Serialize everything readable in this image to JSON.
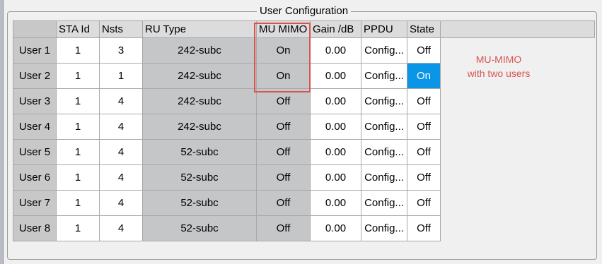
{
  "group": {
    "title": "User Configuration"
  },
  "columns": [
    "STA Id",
    "Nsts",
    "RU Type",
    "MU MIMO",
    "Gain /dB",
    "PPDU",
    "State"
  ],
  "rows": [
    {
      "user": "User 1",
      "sta_id": "1",
      "nsts": "3",
      "ru_type": "242-subc",
      "mu_mimo": "On",
      "gain": "0.00",
      "ppdu": "Config...",
      "state": "Off"
    },
    {
      "user": "User 2",
      "sta_id": "1",
      "nsts": "1",
      "ru_type": "242-subc",
      "mu_mimo": "On",
      "gain": "0.00",
      "ppdu": "Config...",
      "state": "On"
    },
    {
      "user": "User 3",
      "sta_id": "1",
      "nsts": "4",
      "ru_type": "242-subc",
      "mu_mimo": "Off",
      "gain": "0.00",
      "ppdu": "Config...",
      "state": "Off"
    },
    {
      "user": "User 4",
      "sta_id": "1",
      "nsts": "4",
      "ru_type": "242-subc",
      "mu_mimo": "Off",
      "gain": "0.00",
      "ppdu": "Config...",
      "state": "Off"
    },
    {
      "user": "User 5",
      "sta_id": "1",
      "nsts": "4",
      "ru_type": "52-subc",
      "mu_mimo": "Off",
      "gain": "0.00",
      "ppdu": "Config...",
      "state": "Off"
    },
    {
      "user": "User 6",
      "sta_id": "1",
      "nsts": "4",
      "ru_type": "52-subc",
      "mu_mimo": "Off",
      "gain": "0.00",
      "ppdu": "Config...",
      "state": "Off"
    },
    {
      "user": "User 7",
      "sta_id": "1",
      "nsts": "4",
      "ru_type": "52-subc",
      "mu_mimo": "Off",
      "gain": "0.00",
      "ppdu": "Config...",
      "state": "Off"
    },
    {
      "user": "User 8",
      "sta_id": "1",
      "nsts": "4",
      "ru_type": "52-subc",
      "mu_mimo": "Off",
      "gain": "0.00",
      "ppdu": "Config...",
      "state": "Off"
    }
  ],
  "annotation": {
    "line1": "MU-MIMO",
    "line2": "with two users"
  },
  "colors": {
    "state_on": "#0b95e6",
    "highlight": "#d9534f",
    "annotation_text": "#d9534f"
  }
}
